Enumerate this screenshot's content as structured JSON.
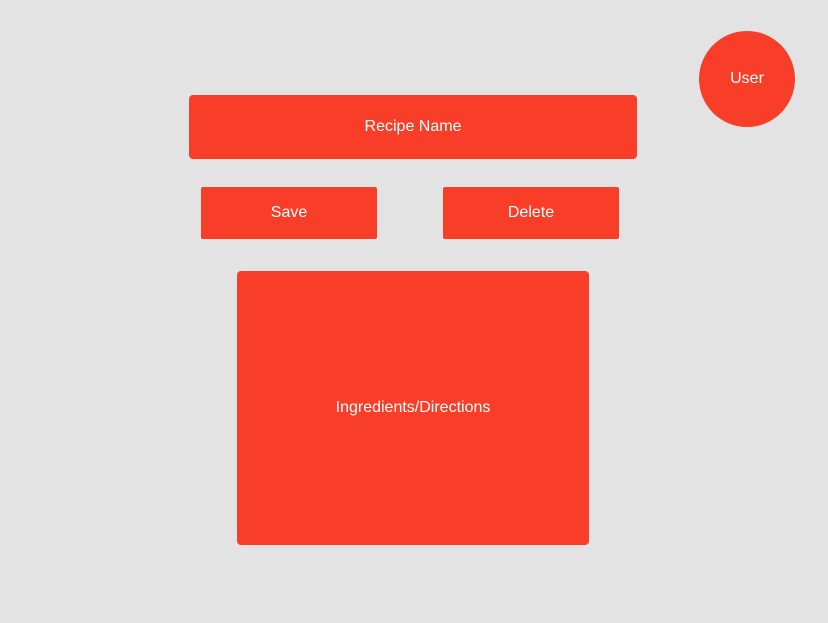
{
  "user": {
    "label": "User"
  },
  "recipe": {
    "name_label": "Recipe Name",
    "body_label": "Ingredients/Directions"
  },
  "actions": {
    "save_label": "Save",
    "delete_label": "Delete"
  },
  "colors": {
    "accent": "#f83e28",
    "background": "#e3e3e3",
    "text": "#ffffff"
  }
}
